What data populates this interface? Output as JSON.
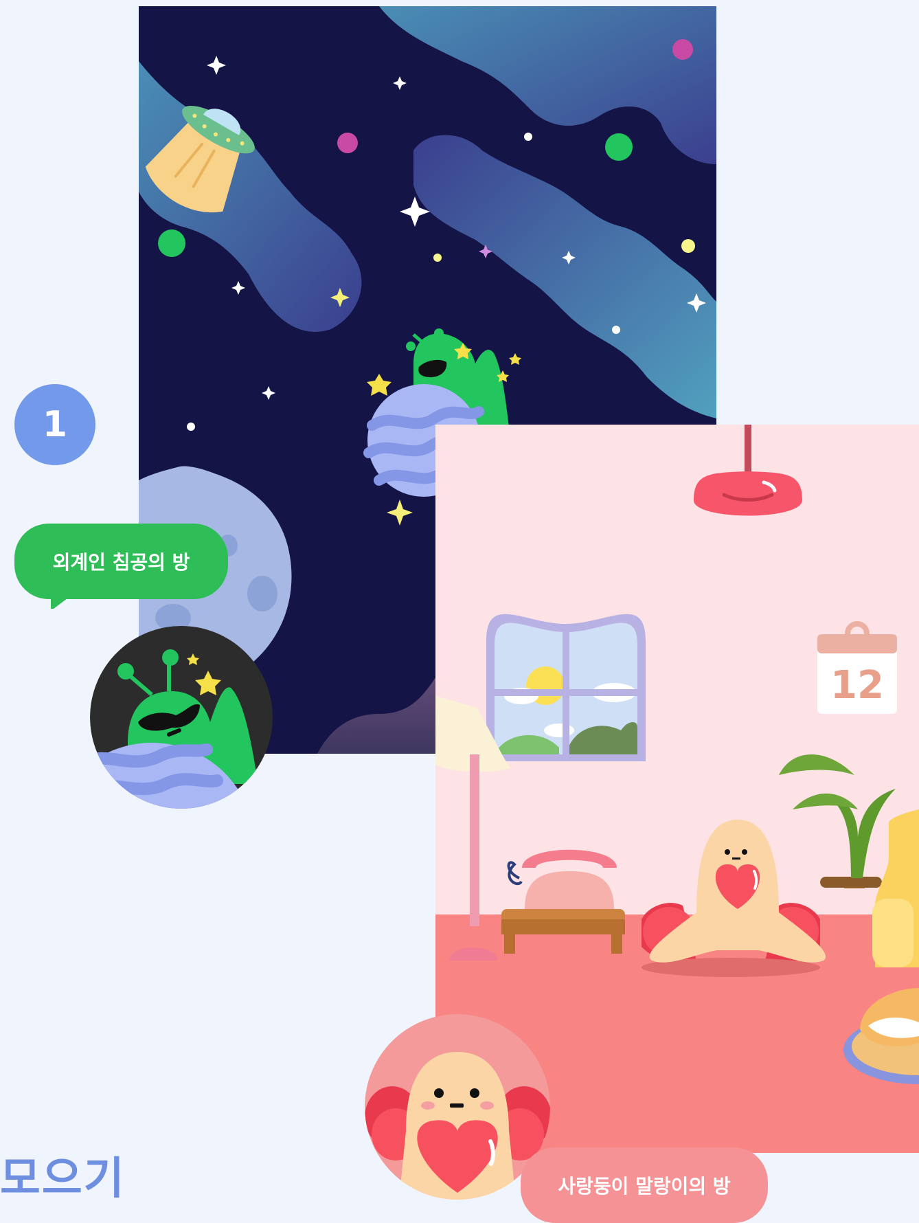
{
  "step": {
    "number": "1"
  },
  "rooms": [
    {
      "id": "alien",
      "label": "외계인 침공의 방"
    },
    {
      "id": "love",
      "label": "사랑둥이 말랑이의 방"
    }
  ],
  "calendar": {
    "day": "12"
  },
  "heading": {
    "text": "모으기"
  },
  "colors": {
    "badge": "#7299ea",
    "alien_bubble": "#2ebd57",
    "love_bubble": "#f49296",
    "space_bg": "#141446",
    "room_wall": "#fde3e5",
    "room_floor": "#f88583",
    "heading": "#6e8ee0"
  },
  "icons": [
    "ufo-icon",
    "alien-icon",
    "planet-icon",
    "moon-icon",
    "star-icon",
    "lamp-icon",
    "calendar-icon",
    "telephone-icon",
    "plant-icon",
    "heart-icon",
    "window-icon",
    "cream-puff-icon"
  ]
}
